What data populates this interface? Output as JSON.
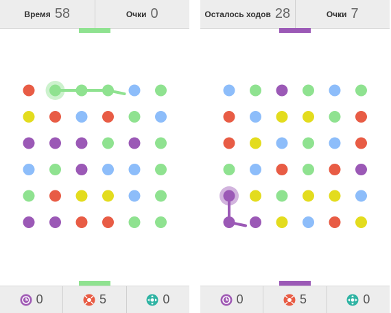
{
  "colors": {
    "red": "#e85c45",
    "green": "#8fe290",
    "blue": "#8dbdfa",
    "yellow": "#e3dc1e",
    "purple": "#9b59b6",
    "bar_bg": "#ededed"
  },
  "left_screen": {
    "stats": [
      {
        "label": "Время",
        "value": "58"
      },
      {
        "label": "Очки",
        "value": "0"
      }
    ],
    "indicator_color": "#8fe290",
    "board": [
      [
        "red",
        "green",
        "green",
        "green",
        "blue",
        "green"
      ],
      [
        "yellow",
        "red",
        "blue",
        "red",
        "green",
        "blue"
      ],
      [
        "purple",
        "purple",
        "purple",
        "green",
        "purple",
        "green"
      ],
      [
        "blue",
        "green",
        "purple",
        "blue",
        "blue",
        "green"
      ],
      [
        "green",
        "red",
        "yellow",
        "yellow",
        "blue",
        "green"
      ],
      [
        "purple",
        "purple",
        "red",
        "red",
        "green",
        "green"
      ]
    ],
    "active_path": {
      "color": "green",
      "cells": [
        [
          0,
          1
        ],
        [
          0,
          2
        ],
        [
          0,
          3
        ]
      ],
      "highlighted_cells": [
        [
          0,
          1
        ]
      ],
      "drag_direction": "right"
    },
    "powerups": [
      {
        "icon": "time-stop-icon",
        "color": "#a05bb5",
        "count": "0"
      },
      {
        "icon": "shrinker-icon",
        "color": "#e85c45",
        "count": "5"
      },
      {
        "icon": "expander-icon",
        "color": "#2fb3a3",
        "count": "0"
      }
    ]
  },
  "right_screen": {
    "stats": [
      {
        "label": "Осталось ходов",
        "value": "28"
      },
      {
        "label": "Очки",
        "value": "7"
      }
    ],
    "indicator_color": "#9b59b6",
    "board": [
      [
        "blue",
        "green",
        "purple",
        "green",
        "blue",
        "green"
      ],
      [
        "red",
        "blue",
        "yellow",
        "yellow",
        "green",
        "red"
      ],
      [
        "red",
        "yellow",
        "blue",
        "green",
        "blue",
        "red"
      ],
      [
        "green",
        "blue",
        "red",
        "green",
        "red",
        "purple"
      ],
      [
        "purple",
        "yellow",
        "green",
        "yellow",
        "yellow",
        "blue"
      ],
      [
        "purple",
        "purple",
        "yellow",
        "blue",
        "red",
        "yellow"
      ]
    ],
    "active_path": {
      "color": "purple",
      "cells": [
        [
          4,
          0
        ],
        [
          5,
          0
        ]
      ],
      "highlighted_cells": [
        [
          4,
          0
        ]
      ],
      "drag_direction": "right"
    },
    "powerups": [
      {
        "icon": "time-stop-icon",
        "color": "#a05bb5",
        "count": "0"
      },
      {
        "icon": "shrinker-icon",
        "color": "#e85c45",
        "count": "5"
      },
      {
        "icon": "expander-icon",
        "color": "#2fb3a3",
        "count": "0"
      }
    ]
  }
}
